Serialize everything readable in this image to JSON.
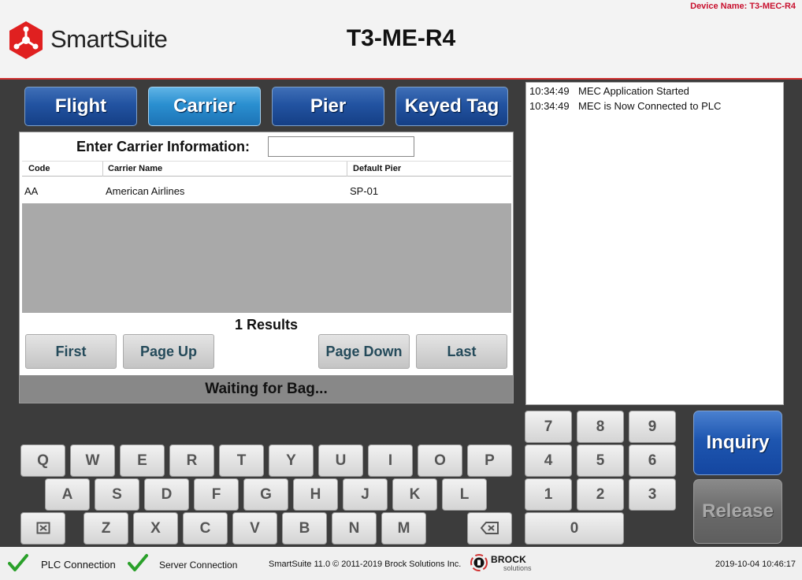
{
  "header": {
    "brand": "SmartSuite",
    "device_title": "T3-ME-R4",
    "device_name": "Device Name: T3-MEC-R4",
    "logo_icon": "smartsuite-hexagon-icon",
    "accent_color": "#e02020"
  },
  "tabs": [
    {
      "label": "Flight",
      "active": false
    },
    {
      "label": "Carrier",
      "active": true
    },
    {
      "label": "Pier",
      "active": false
    },
    {
      "label": "Keyed Tag",
      "active": false
    }
  ],
  "carrier": {
    "prompt": "Enter Carrier Information:",
    "input_value": "",
    "columns": [
      "Code",
      "Carrier Name",
      "Default Pier"
    ],
    "rows": [
      {
        "code": "AA",
        "name": "American Airlines",
        "pier": "SP-01"
      }
    ],
    "results": "1 Results",
    "paging": {
      "first": "First",
      "page_up": "Page Up",
      "page_down": "Page Down",
      "last": "Last"
    }
  },
  "status": "Waiting for Bag...",
  "log": [
    {
      "time": "10:34:49",
      "message": "MEC Application Started"
    },
    {
      "time": "10:34:49",
      "message": "MEC is Now Connected to PLC"
    }
  ],
  "keyboard": {
    "row1": [
      "Q",
      "W",
      "E",
      "R",
      "T",
      "Y",
      "U",
      "I",
      "O",
      "P"
    ],
    "row2": [
      "A",
      "S",
      "D",
      "F",
      "G",
      "H",
      "J",
      "K",
      "L"
    ],
    "row3": [
      "Z",
      "X",
      "C",
      "V",
      "B",
      "N",
      "M"
    ]
  },
  "numpad": {
    "row1": [
      "7",
      "8",
      "9"
    ],
    "row2": [
      "4",
      "5",
      "6"
    ],
    "row3": [
      "1",
      "2",
      "3"
    ],
    "zero": "0"
  },
  "actions": {
    "inquiry": "Inquiry",
    "release": "Release"
  },
  "footer": {
    "plc": "PLC Connection",
    "server": "Server Connection",
    "copyright": "SmartSuite 11.0 © 2011-2019 Brock Solutions Inc.",
    "brock_name": "BROCK",
    "brock_sub": "solutions",
    "datetime": "2019-10-04 10:46:17",
    "status_color": "#2aa02a"
  }
}
